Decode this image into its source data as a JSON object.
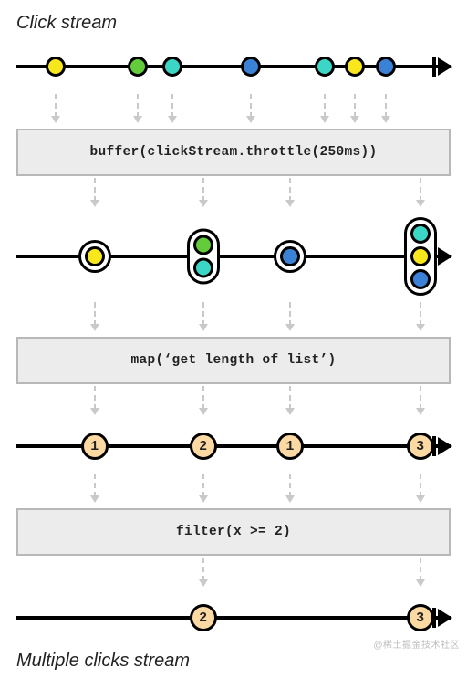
{
  "titles": {
    "top": "Click stream",
    "bottom": "Multiple clicks stream"
  },
  "operators": {
    "buffer": "buffer(clickStream.throttle(250ms))",
    "map": "map(‘get length of list’)",
    "filter": "filter(x >= 2)"
  },
  "colors": {
    "yellow": "#f8e71c",
    "green": "#62cc3a",
    "teal": "#3bd6c6",
    "blue": "#3b82d6",
    "peach": "#fcd9a2"
  },
  "chart_data": {
    "type": "marble-diagram",
    "input_stream": {
      "label": "Click stream",
      "events": [
        {
          "x": 9,
          "color": "yellow"
        },
        {
          "x": 28,
          "color": "green"
        },
        {
          "x": 36,
          "color": "teal"
        },
        {
          "x": 54,
          "color": "blue"
        },
        {
          "x": 71,
          "color": "teal"
        },
        {
          "x": 78,
          "color": "yellow"
        },
        {
          "x": 85,
          "color": "blue"
        }
      ]
    },
    "after_buffer": {
      "operator": "buffer(clickStream.throttle(250ms))",
      "groups": [
        {
          "x": 18,
          "items": [
            "yellow"
          ]
        },
        {
          "x": 43,
          "items": [
            "green",
            "teal"
          ]
        },
        {
          "x": 63,
          "items": [
            "blue"
          ]
        },
        {
          "x": 93,
          "items": [
            "teal",
            "yellow",
            "blue"
          ]
        }
      ]
    },
    "after_map": {
      "operator": "map(‘get length of list’)",
      "values": [
        {
          "x": 18,
          "n": 1
        },
        {
          "x": 43,
          "n": 2
        },
        {
          "x": 63,
          "n": 1
        },
        {
          "x": 93,
          "n": 3
        }
      ]
    },
    "after_filter": {
      "operator": "filter(x >= 2)",
      "values": [
        {
          "x": 43,
          "n": 2
        },
        {
          "x": 93,
          "n": 3
        }
      ]
    },
    "output_stream_label": "Multiple clicks stream"
  },
  "watermark": "@稀土掘金技术社区"
}
